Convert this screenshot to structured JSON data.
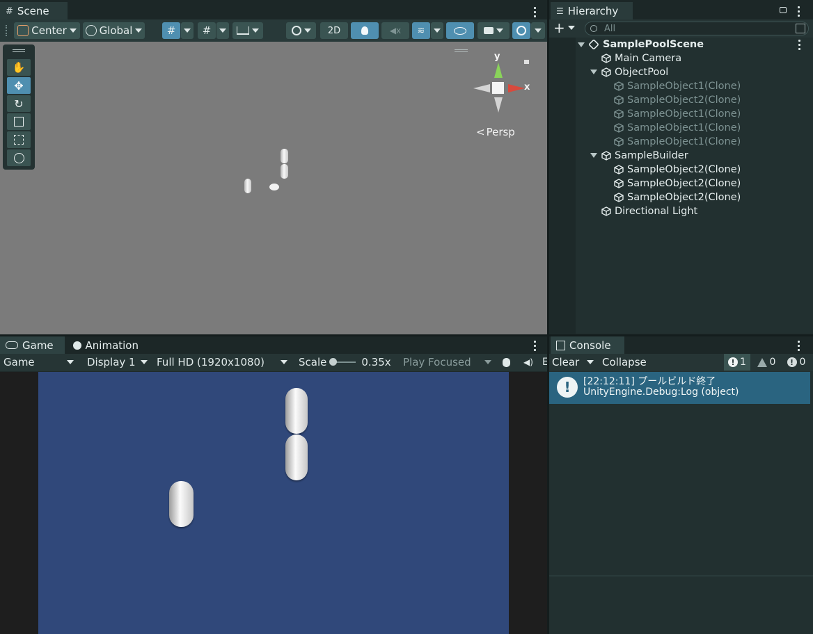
{
  "scene": {
    "tab_label": "Scene",
    "pivot_label": "Center",
    "space_label": "Global",
    "mode_2d_label": "2D",
    "persp_label": "Persp",
    "gizmo_y": "y",
    "gizmo_x": "x",
    "tools": [
      "hand-tool",
      "move-tool",
      "rotate-tool",
      "scale-tool",
      "rect-tool",
      "transform-tool"
    ]
  },
  "hierarchy": {
    "tab_label": "Hierarchy",
    "search_placeholder": "All",
    "scene_name": "SamplePoolScene",
    "items": [
      {
        "label": "Main Camera",
        "active": true
      },
      {
        "label": "ObjectPool",
        "active": true
      },
      {
        "label": "SampleObject1(Clone)",
        "active": false
      },
      {
        "label": "SampleObject2(Clone)",
        "active": false
      },
      {
        "label": "SampleObject1(Clone)",
        "active": false
      },
      {
        "label": "SampleObject1(Clone)",
        "active": false
      },
      {
        "label": "SampleObject1(Clone)",
        "active": false
      },
      {
        "label": "SampleBuilder",
        "active": true
      },
      {
        "label": "SampleObject2(Clone)",
        "active": true
      },
      {
        "label": "SampleObject2(Clone)",
        "active": true
      },
      {
        "label": "SampleObject2(Clone)",
        "active": true
      },
      {
        "label": "Directional Light",
        "active": true
      }
    ]
  },
  "game": {
    "tab_label": "Game",
    "animation_tab_label": "Animation",
    "view_select": "Game",
    "display_select": "Display 1",
    "resolution_select": "Full HD (1920x1080)",
    "scale_label": "Scale",
    "scale_value": "0.35x",
    "play_mode_select": "Play Focused"
  },
  "console": {
    "tab_label": "Console",
    "clear_label": "Clear",
    "collapse_label": "Collapse",
    "info_count": "1",
    "warning_count": "0",
    "error_count": "0",
    "entry_line1": "[22:12:11] プールビルド終了",
    "entry_line2": "UnityEngine.Debug:Log (object)"
  },
  "colors": {
    "accent": "#4f8fb0",
    "game_background": "#30487a",
    "scene_background": "#7b7b7b",
    "panel_background": "#1f2b2b"
  }
}
